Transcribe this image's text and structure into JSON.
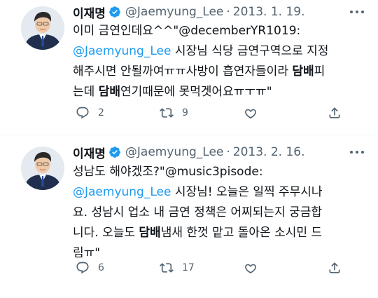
{
  "tweets": [
    {
      "author_name": "이재명",
      "handle": "@Jaemyung_Lee",
      "separator": "·",
      "date": "2013. 1. 19.",
      "lines": [
        [
          {
            "text": "이미 금연인데요^^\"@decemberYR1019:",
            "style": "plain"
          }
        ],
        [
          {
            "text": "@Jaemyung_Lee",
            "style": "mention"
          },
          {
            "text": " 시장님 식당 금연구역으로 지정",
            "style": "plain"
          }
        ],
        [
          {
            "text": "해주시면 안될까여ㅠㅠ사방이 흡연자들이라 ",
            "style": "plain"
          },
          {
            "text": "담배",
            "style": "bold"
          },
          {
            "text": "피",
            "style": "plain"
          }
        ],
        [
          {
            "text": "는데 ",
            "style": "plain"
          },
          {
            "text": "담배",
            "style": "bold"
          },
          {
            "text": "연기때문에 못먹겟어요ㅠㅜㅠ\"",
            "style": "plain"
          }
        ]
      ],
      "reply_count": "2",
      "retweet_count": "9",
      "like_count": "",
      "share_count": ""
    },
    {
      "author_name": "이재명",
      "handle": "@Jaemyung_Lee",
      "separator": "·",
      "date": "2013. 2. 16.",
      "lines": [
        [
          {
            "text": "성남도 해야겠조?\"@music3pisode:",
            "style": "plain"
          }
        ],
        [
          {
            "text": "@Jaemyung_Lee",
            "style": "mention"
          },
          {
            "text": " 시장님! 오늘은 일찍 주무시나",
            "style": "plain"
          }
        ],
        [
          {
            "text": "요. 성남시 업소 내 금연 정책은 어찌되는지 궁금합",
            "style": "plain"
          }
        ],
        [
          {
            "text": "니다. 오늘도 ",
            "style": "plain"
          },
          {
            "text": "담배",
            "style": "bold"
          },
          {
            "text": "냄새 한껏 맡고 돌아온 소시민 드",
            "style": "plain"
          }
        ],
        [
          {
            "text": "림ㅠ\"",
            "style": "plain"
          }
        ]
      ],
      "reply_count": "6",
      "retweet_count": "17",
      "like_count": "",
      "share_count": ""
    }
  ],
  "colors": {
    "text": "#0f1419",
    "secondary": "#536471",
    "accent": "#1d9bf0",
    "divider": "#eff3f4"
  },
  "icons": {
    "verified": "verified-badge-icon",
    "more": "more-dots-icon",
    "reply": "reply-bubble-icon",
    "retweet": "retweet-arrows-icon",
    "like": "heart-icon",
    "share": "share-upload-icon"
  }
}
